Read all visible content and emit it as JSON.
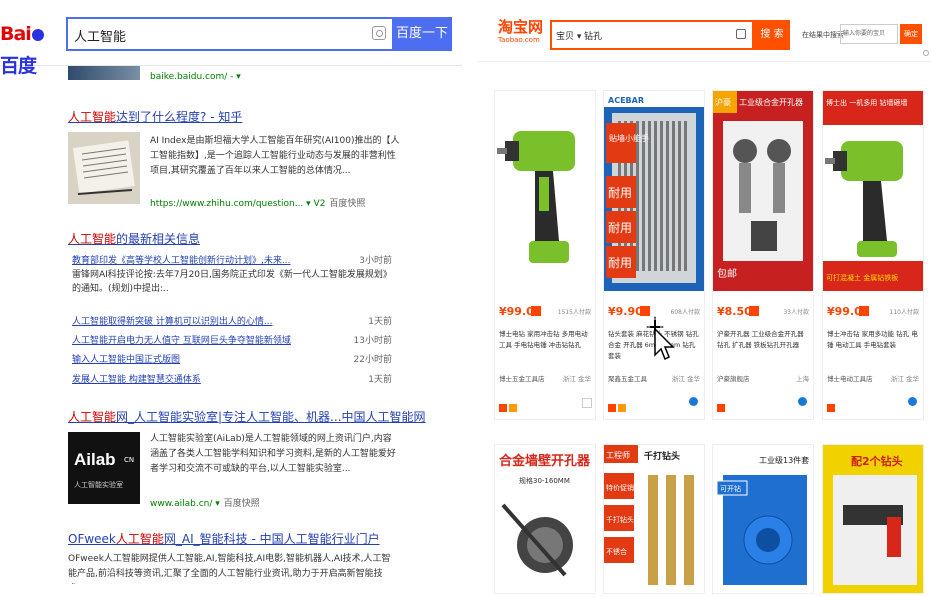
{
  "baidu": {
    "logo_left": "Bai",
    "logo_right": "百度",
    "search_value": "人工智能",
    "search_button": "百度一下",
    "top_url": "baike.baidu.com/ - ▾ ",
    "results": [
      {
        "title_pre": "",
        "title_hl": "人工智能",
        "title_post": "达到了什么程度? - 知乎",
        "snippet": "AI Index是由斯坦福大学人工智能百年研究(AI100)推出的【人工智能指数】,是一个追踪人工智能行业动态与发展的非营利性项目,其研究覆盖了百年以来人工智能的总体情况...",
        "url": "https://www.zhihu.com/question... ▾ V2",
        "snapshot": "百度快照"
      },
      {
        "title_pre": "",
        "title_hl": "人工智能",
        "title_post": "的最新相关信息"
      },
      {
        "title_pre": "",
        "title_hl": "人工智能",
        "title_post": "网_人工智能实验室|专注人工智能、机器...中国人工智能网",
        "snippet": "人工智能实验室(AiLab)是人工智能领域的网上资讯门户,内容涵盖了各类人工智能学科知识和学习资料,是新的人工智能爱好者学习和交流不可或缺的平台,以人工智能实验室...",
        "url": "www.ailab.cn/ ▾",
        "snapshot": "百度快照"
      },
      {
        "title_pre": "OFweek",
        "title_hl": "人工智能",
        "title_post": "网_AI_智能科技 - 中国人工智能行业门户",
        "snippet": "OFweek人工智能网提供人工智能,AI,智能科技,AI电影,智能机器人,AI技术,人工智能产品,前沿科技等资讯,汇聚了全面的人工智能行业资讯,助力于开启高新智能技术..."
      }
    ],
    "news": [
      {
        "title": "教育部印发《高等学校人工智能创新行动计划》,未来...",
        "source": "雷锋网",
        "time": "3小时前"
      },
      {
        "title": "雷锋网AI科技评论按:去年7月20日,国务院正式印发《新一代人工智能发展规划》的通知。(规划)中提出:..",
        "source": "",
        "time": ""
      },
      {
        "title": "人工智能取得新突破 计算机可以识别出人的心情...",
        "source": "36kr",
        "time": "1天前"
      },
      {
        "title": "人工智能开启电力无人值守 互联网巨头争夺智能新领域",
        "source": "新浪",
        "time": "13小时前"
      },
      {
        "title": "输入人工智能中国正式版图",
        "source": "凤凰网",
        "time": "22小时前"
      },
      {
        "title": "发展人工智能 构建智慧交通体系",
        "source": "新浪新闻",
        "time": "1天前"
      }
    ],
    "ailab_logo": "Ailab",
    "ailab_sub": "人工智能实验室"
  },
  "taobao": {
    "logo_cn": "淘宝网",
    "logo_en": "Taobao.com",
    "category": "宝贝 ▾",
    "query": "钻孔",
    "search_button": "搜 索",
    "shop_label": "在结果中搜索",
    "shop_placeholder": "输入你要的宝贝",
    "shop_button": "确定",
    "products": [
      {
        "price": "¥99.00",
        "sold": "1515人付款",
        "title": "博士电钻 家用冲击钻 多用电动工具 手电钻电锤 冲击钻钻孔",
        "shop": "博士五金工具店",
        "loc": "浙江 金华"
      },
      {
        "price": "¥9.90",
        "sold": "608人付款",
        "title": "钻头套装 麻花钻头 不锈钢 钻孔 合金 开孔器 6mm 8mm 钻孔 套装",
        "shop": "聚鑫五金工具",
        "loc": "浙江 金华"
      },
      {
        "price": "¥8.50",
        "sold": "33人付款",
        "title": "沪豪开孔器 工业级合金开孔器 钻孔 扩孔器 铁板钻孔开孔器",
        "shop": "沪豪旗舰店",
        "loc": "上海"
      },
      {
        "price": "¥99.00",
        "sold": "110人付款",
        "title": "博士冲击钻 家用多功能 钻孔 电锤 电动工具 手电钻套装",
        "shop": "博士电动工具店",
        "loc": "浙江 金华"
      }
    ],
    "banner_texts": {
      "p1_brand": "ACEBAR",
      "p2_top": "贴墙小能手",
      "p2_words": [
        "耐用",
        "耐用",
        "耐用"
      ],
      "p3_tag": "沪豪",
      "p3_title": "工业级合金开孔器",
      "p3_bottom": "包邮",
      "p4_top": "博士出 一机多用 钻墙砸墙",
      "p4_bottom": "可打混凝土 金属钻铁板",
      "q1": "合金墙壁开孔器",
      "q1_sub": "规格30-160MM",
      "q2_top": "工程师",
      "q2_mid": "千打钻头",
      "q2_words": [
        "特价促销",
        "千打钻头",
        "不锈合"
      ],
      "q3": "工业级13件套",
      "q3_sub": "可开钻",
      "q4": "配2个钻头"
    }
  }
}
